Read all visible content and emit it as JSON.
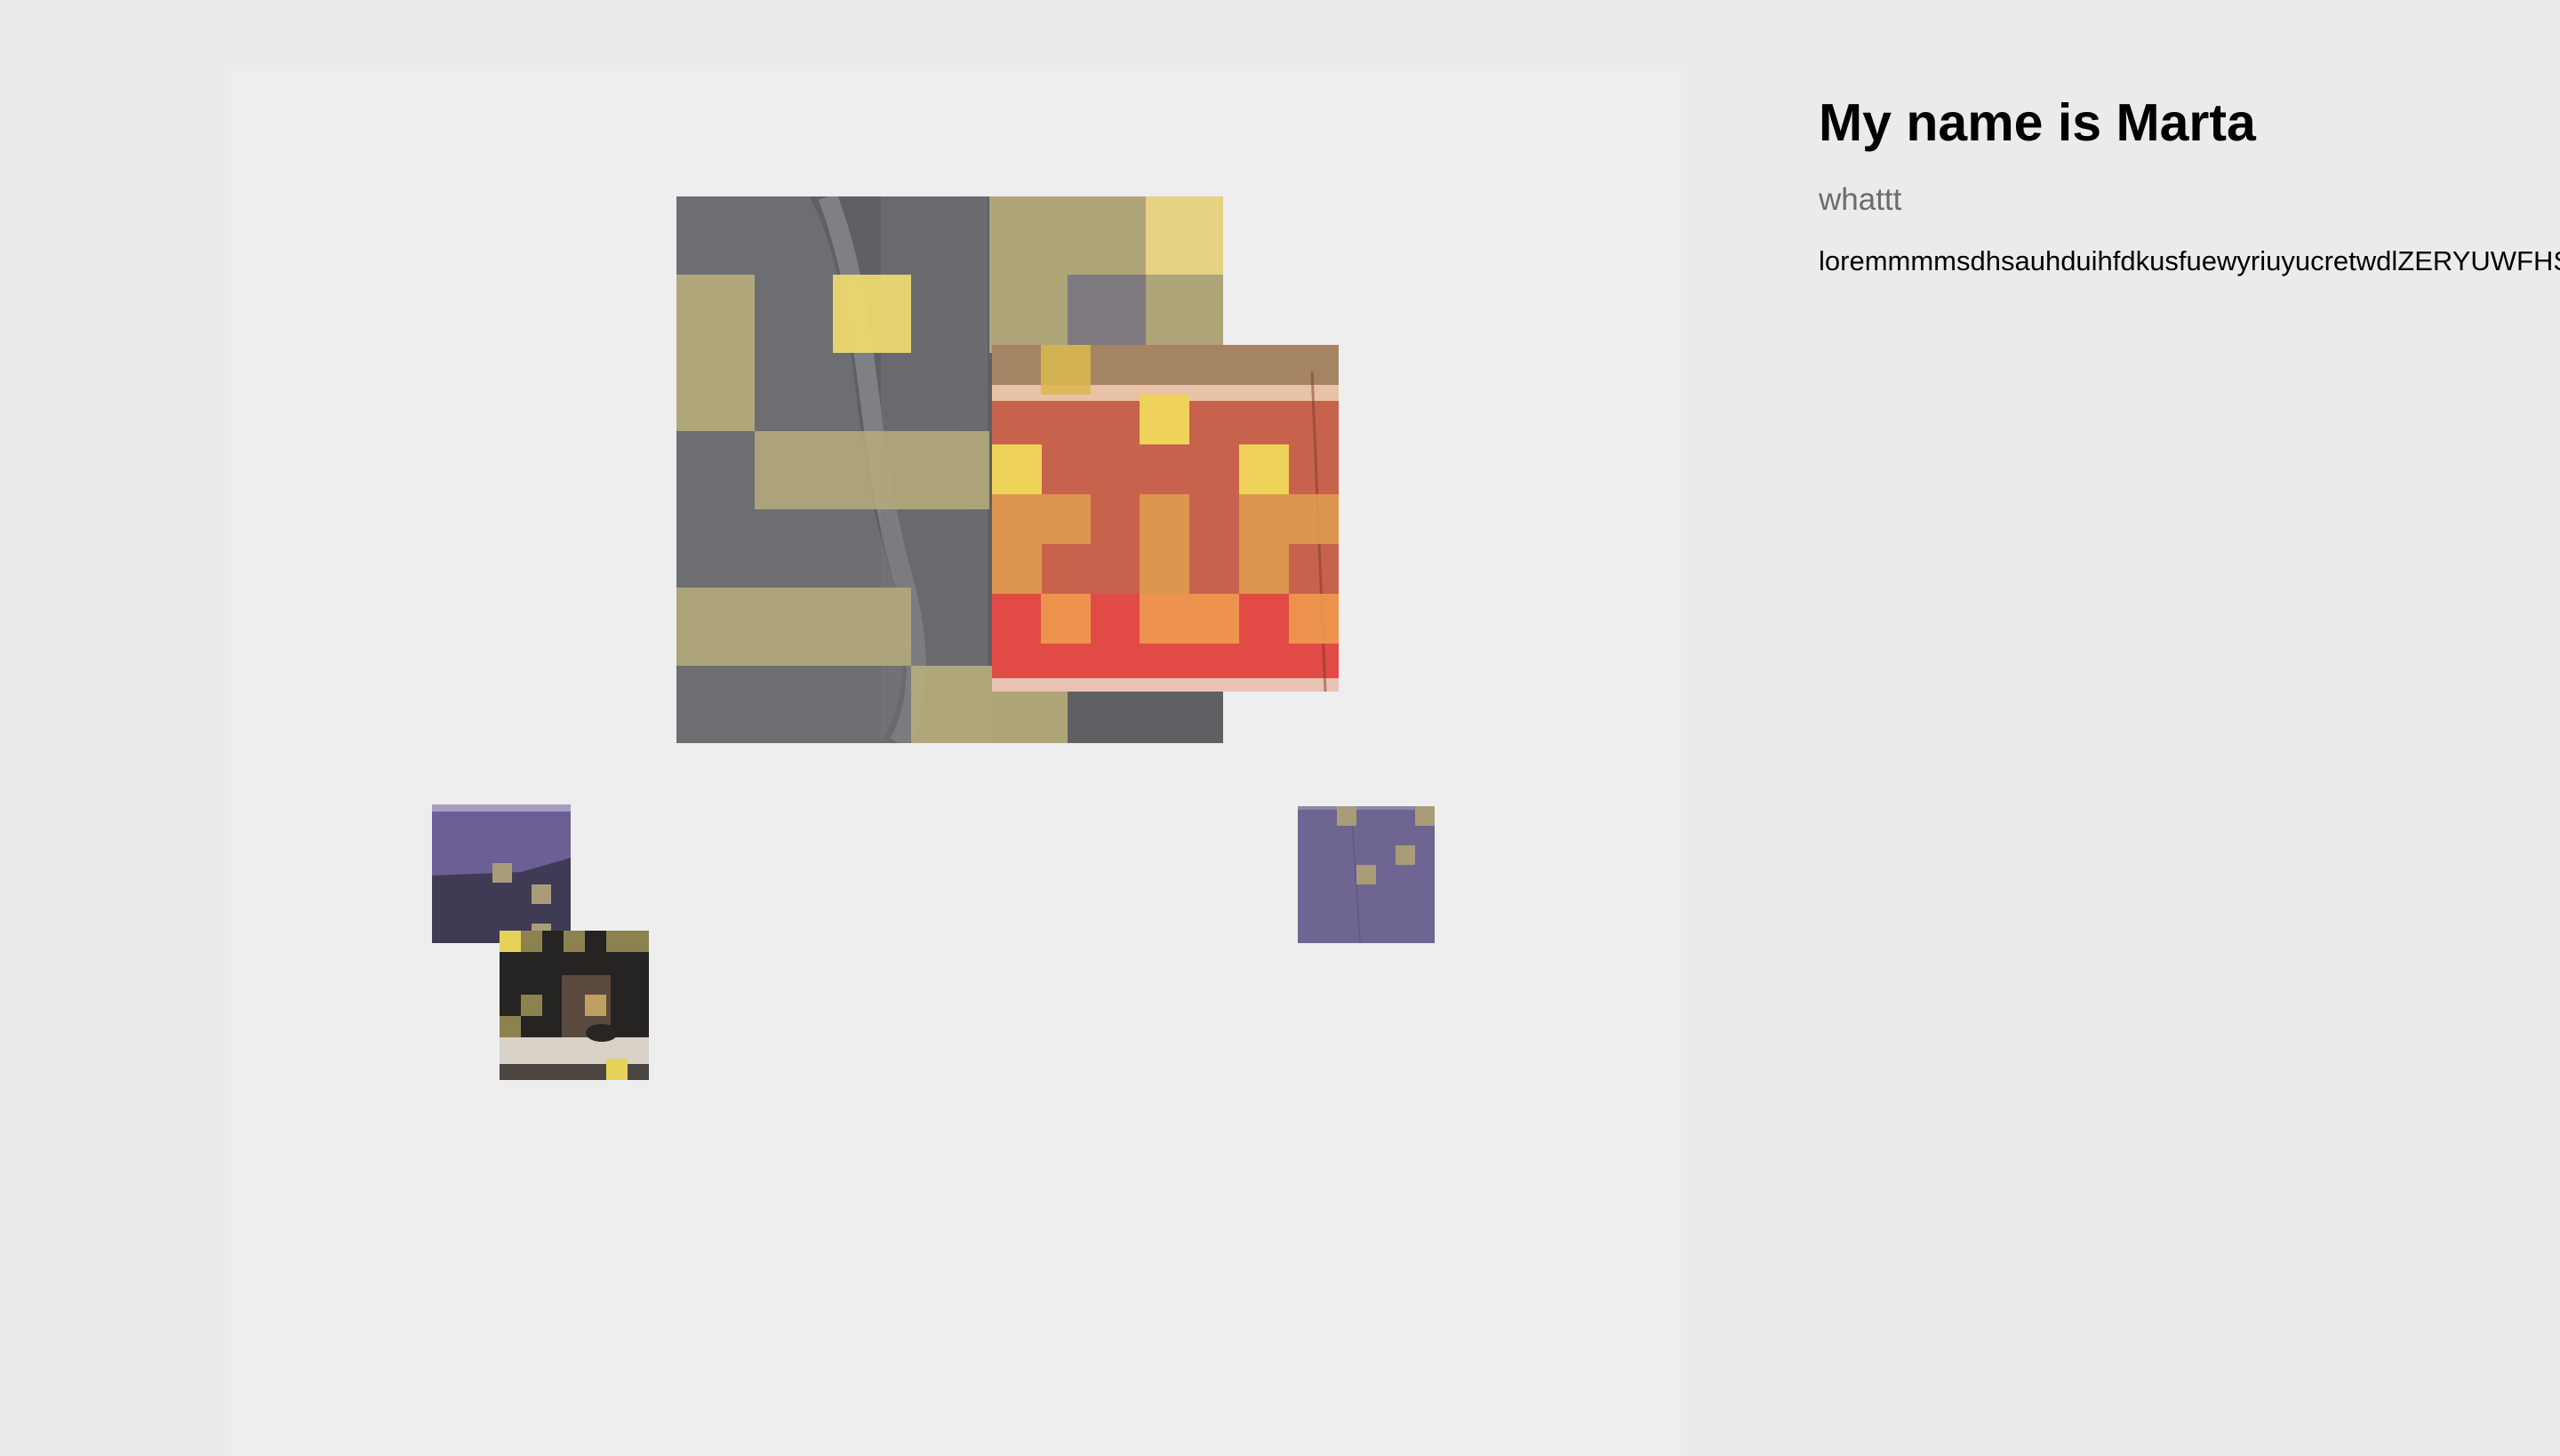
{
  "profile": {
    "title": "My name is Marta",
    "subtitle": "whattt",
    "body": "loremmmmsdhsauhduihfdkusfuewyriuyucretwdlZERYUWFHSDFKJHSKUYREUWYRIYEWURYEWRYWEUIRYUEIWRYIWUERY"
  },
  "colors": {
    "page_background": "#ebebeb",
    "stage_background": "#eeeeee",
    "overlay_yellow": "#ecd85f",
    "overlay_olive": "#b7ad7b",
    "title_text": "#000000",
    "subtitle_text": "#6b6b6b"
  },
  "tiles": [
    {
      "name": "grey-shirt-tile",
      "icon": "pixelated-photo"
    },
    {
      "name": "red-curb-tile",
      "icon": "pixelated-photo"
    },
    {
      "name": "purple-left-tile",
      "icon": "pixelated-photo"
    },
    {
      "name": "dark-room-tile",
      "icon": "pixelated-photo"
    },
    {
      "name": "purple-right-tile",
      "icon": "pixelated-photo"
    }
  ]
}
